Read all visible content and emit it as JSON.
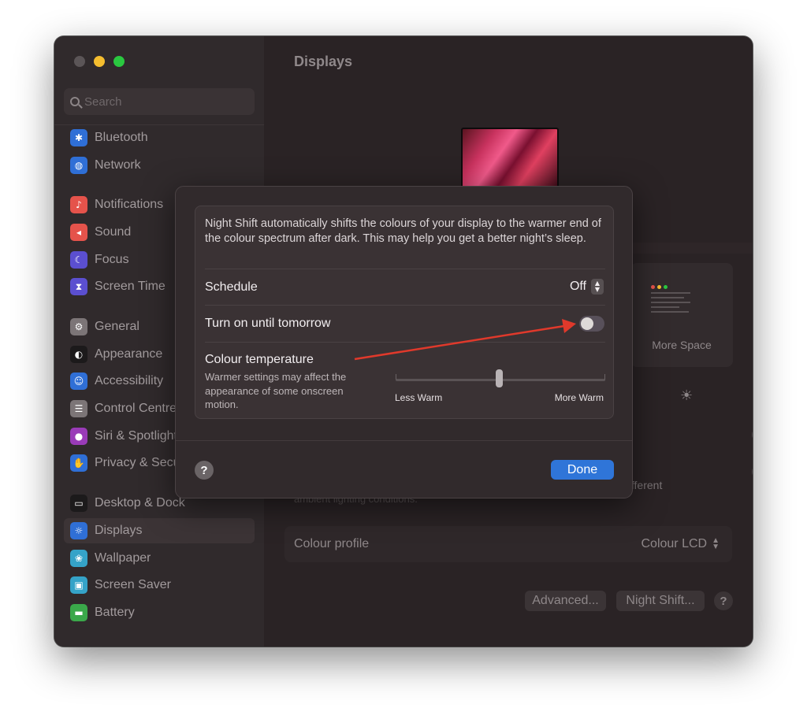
{
  "window": {
    "title": "Displays",
    "search_placeholder": "Search"
  },
  "sidebar": {
    "items": [
      {
        "label": "Bluetooth",
        "icon": "bluetooth-icon",
        "color": "#2f6fd6",
        "glyph": "✱"
      },
      {
        "label": "Network",
        "icon": "globe-icon",
        "color": "#2f6fd6",
        "glyph": "◍"
      },
      {
        "label": "Notifications",
        "icon": "bell-icon",
        "color": "#e5534b",
        "glyph": "♪"
      },
      {
        "label": "Sound",
        "icon": "speaker-icon",
        "color": "#e5534b",
        "glyph": "◂"
      },
      {
        "label": "Focus",
        "icon": "moon-icon",
        "color": "#5b4fd0",
        "glyph": "☾"
      },
      {
        "label": "Screen Time",
        "icon": "hourglass-icon",
        "color": "#5b4fd0",
        "glyph": "⧗"
      },
      {
        "label": "General",
        "icon": "gear-icon",
        "color": "#7c7577",
        "glyph": "⚙"
      },
      {
        "label": "Appearance",
        "icon": "appearance-icon",
        "color": "#1c1a1b",
        "glyph": "◐"
      },
      {
        "label": "Accessibility",
        "icon": "accessibility-icon",
        "color": "#2f6fd6",
        "glyph": "☺"
      },
      {
        "label": "Control Centre",
        "icon": "control-centre-icon",
        "color": "#7c7577",
        "glyph": "☰"
      },
      {
        "label": "Siri & Spotlight",
        "icon": "siri-icon",
        "color": "#9a3bb8",
        "glyph": "●"
      },
      {
        "label": "Privacy & Security",
        "icon": "hand-icon",
        "color": "#2f6fd6",
        "glyph": "✋"
      },
      {
        "label": "Desktop & Dock",
        "icon": "dock-icon",
        "color": "#1c1a1b",
        "glyph": "▭"
      },
      {
        "label": "Displays",
        "icon": "sun-icon",
        "color": "#2f6fd6",
        "glyph": "☼",
        "active": true
      },
      {
        "label": "Wallpaper",
        "icon": "wallpaper-icon",
        "color": "#35a3c8",
        "glyph": "❀"
      },
      {
        "label": "Screen Saver",
        "icon": "screen-saver-icon",
        "color": "#35a3c8",
        "glyph": "▣"
      },
      {
        "label": "Battery",
        "icon": "battery-icon",
        "color": "#3aa84a",
        "glyph": "▬"
      }
    ]
  },
  "main": {
    "preset_label": "More Space",
    "different_text": "different",
    "ambient_text": "ambient lighting conditions.",
    "colour_profile_label": "Colour profile",
    "colour_profile_value": "Colour LCD",
    "advanced_label": "Advanced...",
    "night_shift_label": "Night Shift...",
    "help_label": "?"
  },
  "sheet": {
    "description": "Night Shift automatically shifts the colours of your display to the warmer end of the colour spectrum after dark. This may help you get a better night’s sleep.",
    "schedule_label": "Schedule",
    "schedule_value": "Off",
    "turn_on_label": "Turn on until tomorrow",
    "turn_on_enabled": false,
    "colour_temp_label": "Colour temperature",
    "colour_temp_subtext": "Warmer settings may affect the appearance of some onscreen motion.",
    "slider_min_label": "Less Warm",
    "slider_max_label": "More Warm",
    "slider_value": 0.5,
    "help_label": "?",
    "done_label": "Done"
  },
  "colors": {
    "accent": "#2f75d8",
    "annotation_arrow": "#e0392b"
  }
}
